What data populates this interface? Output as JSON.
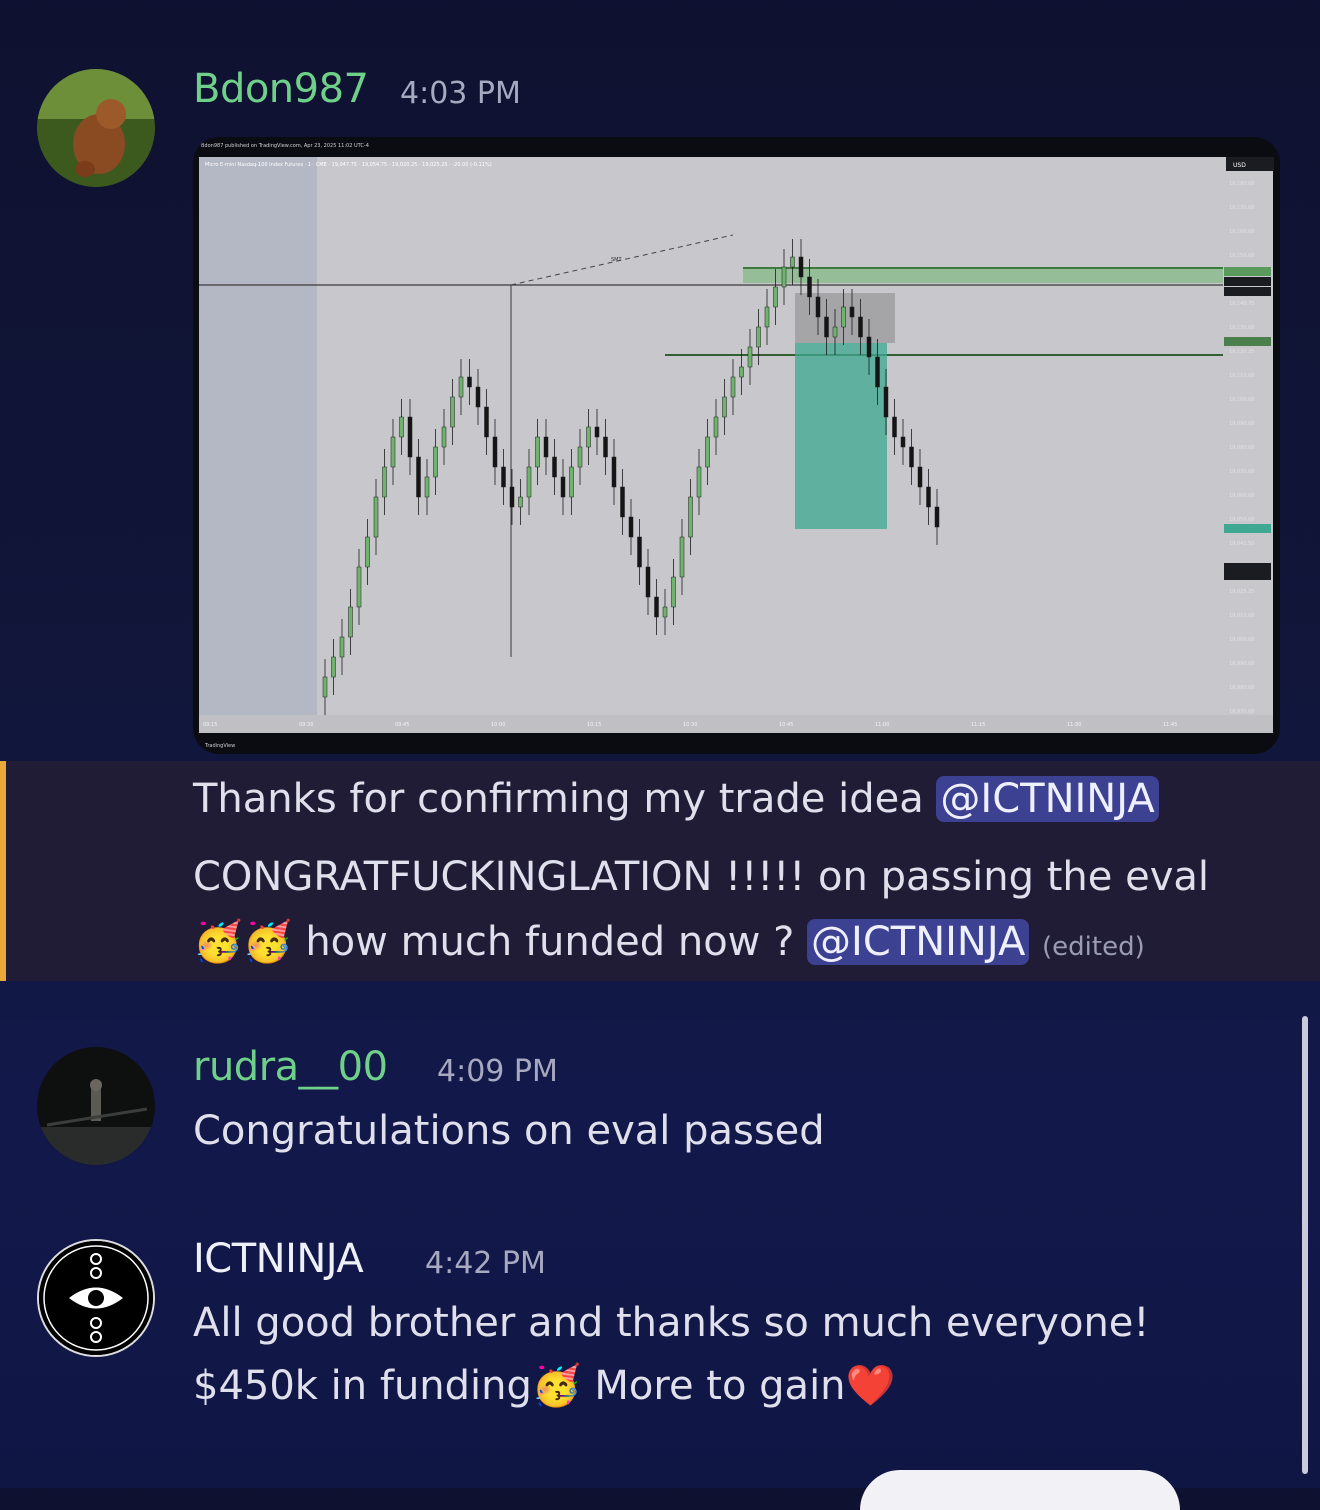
{
  "messages": [
    {
      "author": "Bdon987",
      "author_color": "#6fd08a",
      "time": "4:03 PM",
      "attachment": {
        "header_line1": "Bdon987 published on TradingView.com, Apr 23, 2025 11:02 UTC-4",
        "header_line2": "Micro E-mini Nasdaq-100 Index Futures · 1 · CME · 19,047.75 · 19,054.75 · 19,020.25 · 19,025.25 · -20.00 (-0.11%)",
        "currency": "USD",
        "x_ticks": [
          "09:15",
          "09:30",
          "09:45",
          "10:00",
          "10:15",
          "10:30",
          "10:45",
          "11:00",
          "11:15",
          "11:30",
          "11:45"
        ],
        "y_ticks": [
          "19,180.00",
          "19,170.00",
          "19,160.00",
          "19,150.00",
          "19,144.75",
          "19,140.75",
          "19,130.00",
          "19,120.25",
          "19,110.00",
          "19,100.00",
          "19,090.00",
          "19,080.00",
          "19,070.00",
          "19,060.00",
          "19,050.00",
          "19,041.50",
          "19,030.00",
          "19,025.25",
          "19,010.00",
          "19,000.00",
          "18,990.00",
          "18,980.00",
          "18,970.00"
        ],
        "smt_label": "SMT",
        "footer": "TradingView"
      }
    },
    {
      "line1_text": "Thanks for confirming my trade idea ",
      "line1_mention": "@ICTNINJA",
      "line2_text": "CONGRATFUCKINGLATION !!!!! on passing the eval",
      "line3_emoji": "🥳🥳",
      "line3_text": " how much funded now ? ",
      "line3_mention": "@ICTNINJA",
      "line3_edited": "(edited)"
    },
    {
      "author": "rudra__00",
      "author_color": "#6fd08a",
      "time": "4:09 PM",
      "text": "Congratulations on eval passed"
    },
    {
      "author": "ICTNINJA",
      "author_color": "#eef0f8",
      "time": "4:42 PM",
      "line1": "All good brother and thanks so much everyone!",
      "line2_a": "$450k in funding",
      "line2_emoji": "🥳",
      "line2_b": " More to gain",
      "line2_heart": "❤️"
    }
  ]
}
